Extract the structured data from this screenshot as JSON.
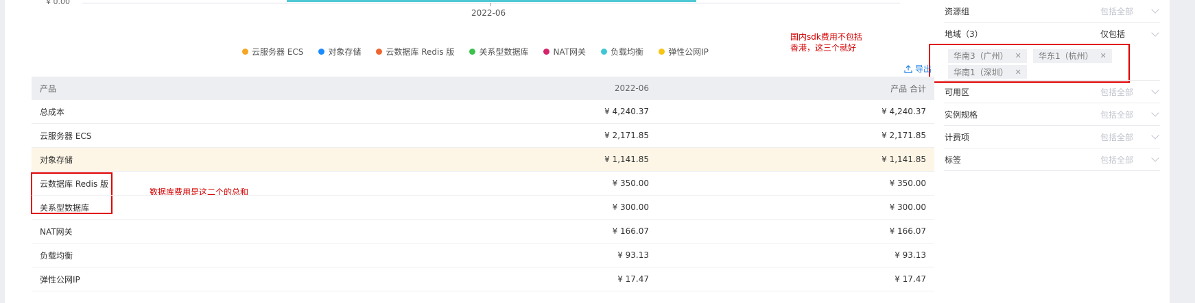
{
  "chart": {
    "ytick_label": "¥ 0.00",
    "xtick_label": "2022-06",
    "legend": [
      {
        "label": "云服务器 ECS",
        "color": "#f5a623"
      },
      {
        "label": "对象存储",
        "color": "#1a8cff"
      },
      {
        "label": "云数据库 Redis 版",
        "color": "#f0642d"
      },
      {
        "label": "关系型数据库",
        "color": "#3cc24d"
      },
      {
        "label": "NAT网关",
        "color": "#d4256b"
      },
      {
        "label": "负载均衡",
        "color": "#3fc6d4"
      },
      {
        "label": "弹性公网IP",
        "color": "#f6c516"
      }
    ]
  },
  "annotations": {
    "region_note_line1": "国内sdk费用不包括",
    "region_note_line2": "香港，这三个就好",
    "db_note": "数据库费用是这二个的总和"
  },
  "export_label": "导出",
  "table": {
    "headers": [
      "产品",
      "2022-06",
      "产品 合计"
    ],
    "rows": [
      {
        "product": "总成本",
        "month": "¥ 4,240.37",
        "total": "¥ 4,240.37"
      },
      {
        "product": "云服务器 ECS",
        "month": "¥ 2,171.85",
        "total": "¥ 2,171.85"
      },
      {
        "product": "对象存储",
        "month": "¥ 1,141.85",
        "total": "¥ 1,141.85"
      },
      {
        "product": "云数据库 Redis 版",
        "month": "¥ 350.00",
        "total": "¥ 350.00"
      },
      {
        "product": "关系型数据库",
        "month": "¥ 300.00",
        "total": "¥ 300.00"
      },
      {
        "product": "NAT网关",
        "month": "¥ 166.07",
        "total": "¥ 166.07"
      },
      {
        "product": "负载均衡",
        "month": "¥ 93.13",
        "total": "¥ 93.13"
      },
      {
        "product": "弹性公网IP",
        "month": "¥ 17.47",
        "total": "¥ 17.47"
      }
    ]
  },
  "filters": {
    "resource_group": {
      "label": "资源组",
      "value": "包括全部"
    },
    "region": {
      "label": "地域（3）",
      "value": "仅包括"
    },
    "region_tags": [
      "华南3（广州）",
      "华东1（杭州）",
      "华南1（深圳）"
    ],
    "zone": {
      "label": "可用区",
      "value": "包括全部"
    },
    "instance_spec": {
      "label": "实例规格",
      "value": "包括全部"
    },
    "billing_item": {
      "label": "计费项",
      "value": "包括全部"
    },
    "tag": {
      "label": "标签",
      "value": "包括全部"
    }
  }
}
